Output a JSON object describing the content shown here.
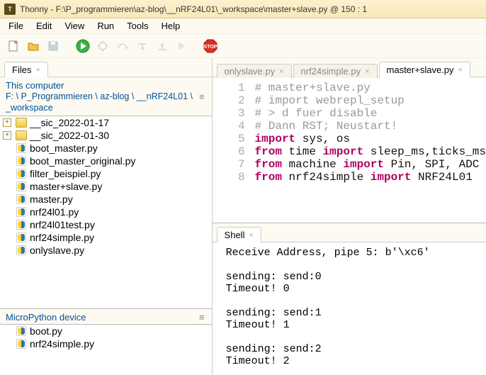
{
  "title": "Thonny  -  F:\\P_programmieren\\az-blog\\__nRF24L01\\_workspace\\master+slave.py  @  150 : 1",
  "menu": [
    "File",
    "Edit",
    "View",
    "Run",
    "Tools",
    "Help"
  ],
  "files_panel": {
    "tab": "Files",
    "header": "This computer",
    "path": "F: \\ P_Programmieren \\ az-blog \\ __nRF24L01 \\ _workspace",
    "items": [
      {
        "type": "folder",
        "expander": "+",
        "name": "__sic_2022-01-17"
      },
      {
        "type": "folder",
        "expander": "+",
        "name": "__sic_2022-01-30"
      },
      {
        "type": "py",
        "name": "boot_master.py"
      },
      {
        "type": "py",
        "name": "boot_master_original.py"
      },
      {
        "type": "py",
        "name": "filter_beispiel.py"
      },
      {
        "type": "py",
        "name": "master+slave.py"
      },
      {
        "type": "py",
        "name": "master.py"
      },
      {
        "type": "py",
        "name": "nrf24l01.py"
      },
      {
        "type": "py",
        "name": "nrf24l01test.py"
      },
      {
        "type": "py",
        "name": "nrf24simple.py"
      },
      {
        "type": "py",
        "name": "onlyslave.py"
      }
    ],
    "device_header": "MicroPython device",
    "device_items": [
      {
        "type": "py",
        "name": "boot.py"
      },
      {
        "type": "py",
        "name": "nrf24simple.py"
      }
    ]
  },
  "editor": {
    "tabs": [
      {
        "label": "onlyslave.py",
        "active": false
      },
      {
        "label": "nrf24simple.py",
        "active": false
      },
      {
        "label": "master+slave.py",
        "active": true
      }
    ],
    "lines": [
      {
        "n": 1,
        "segs": [
          {
            "cls": "c-comment",
            "t": "# master+slave.py"
          }
        ]
      },
      {
        "n": 2,
        "segs": [
          {
            "cls": "c-comment",
            "t": "# import webrepl_setup"
          }
        ]
      },
      {
        "n": 3,
        "segs": [
          {
            "cls": "c-comment",
            "t": "# > d fuer disable"
          }
        ]
      },
      {
        "n": 4,
        "segs": [
          {
            "cls": "c-comment",
            "t": "# Dann RST; Neustart!"
          }
        ]
      },
      {
        "n": 5,
        "segs": [
          {
            "cls": "c-kw",
            "t": "import"
          },
          {
            "cls": "c-id",
            "t": " sys, os"
          }
        ]
      },
      {
        "n": 6,
        "segs": [
          {
            "cls": "c-kw",
            "t": "from"
          },
          {
            "cls": "c-id",
            "t": " time "
          },
          {
            "cls": "c-kw",
            "t": "import"
          },
          {
            "cls": "c-id",
            "t": " sleep_ms,ticks_ms"
          }
        ]
      },
      {
        "n": 7,
        "segs": [
          {
            "cls": "c-kw",
            "t": "from"
          },
          {
            "cls": "c-id",
            "t": " machine "
          },
          {
            "cls": "c-kw",
            "t": "import"
          },
          {
            "cls": "c-id",
            "t": " Pin, SPI, ADC"
          }
        ]
      },
      {
        "n": 8,
        "segs": [
          {
            "cls": "c-kw",
            "t": "from"
          },
          {
            "cls": "c-id",
            "t": " nrf24simple "
          },
          {
            "cls": "c-kw",
            "t": "import"
          },
          {
            "cls": "c-id",
            "t": " NRF24L01"
          }
        ]
      }
    ]
  },
  "shell": {
    "tab": "Shell",
    "text": " Receive Address, pipe 5: b'\\xc6'\n\n sending: send:0\n Timeout! 0\n\n sending: send:1\n Timeout! 1\n\n sending: send:2\n Timeout! 2"
  }
}
